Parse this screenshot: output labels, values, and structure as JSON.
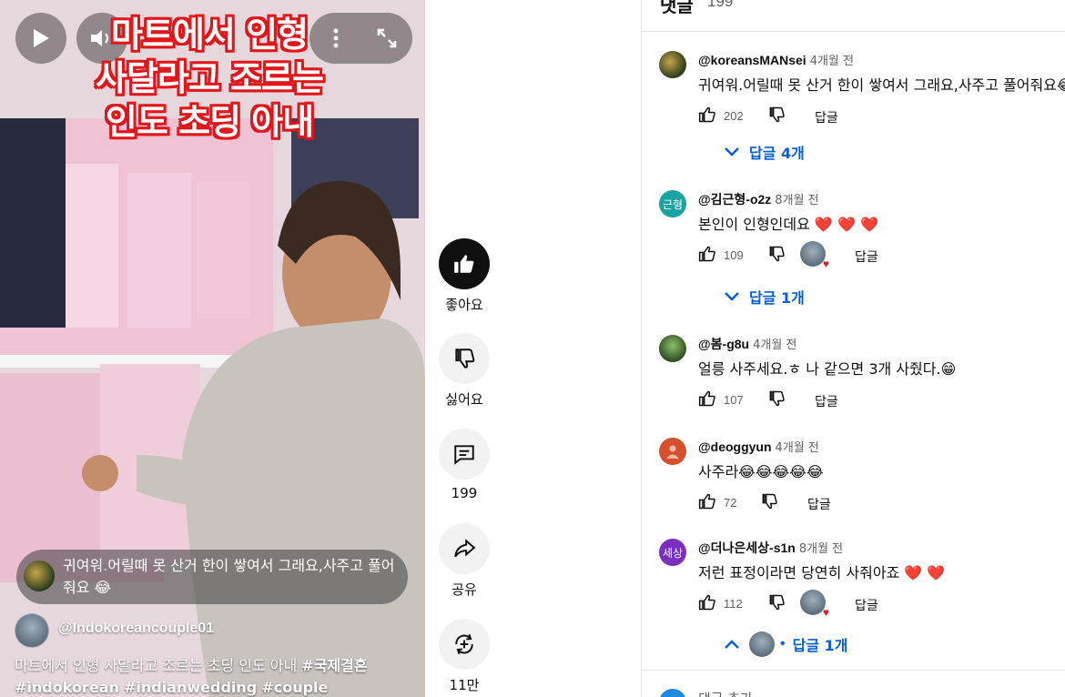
{
  "video": {
    "title_overlay": [
      "마트에서 인형",
      "사달라고 조르는",
      "인도 초딩 아내"
    ],
    "pinned_comment": "귀여워.어릴때 못 산거 한이 쌓여서 그래요,사주고 풀어줘요 😂",
    "channel": "@Indokoreancouple01",
    "description_text": "마트에서 인형 사달라고 조르는 초딩 인도 아내 ",
    "tags": [
      "#국제결혼",
      "#indokorean",
      "#indianwedding",
      "#couple"
    ]
  },
  "actions": {
    "like_label": "좋아요",
    "dislike_label": "싫어요",
    "comments_count": "199",
    "share_label": "공유",
    "remix_count": "11만"
  },
  "panel": {
    "title": "댓글",
    "count": "199",
    "add_comment_placeholder": "댓글 추가..."
  },
  "comments": [
    {
      "author": "@koreansMANsei",
      "time": "4개월 전",
      "text": "귀여워.어릴때 못 산거 한이 쌓여서 그래요,사주고 풀어줘요😂",
      "likes": "202",
      "reply": "답글",
      "replies": "답글 4개",
      "avatar_color": "#5a6b2a"
    },
    {
      "author": "@김근형-o2z",
      "time": "8개월 전",
      "text": "본인이 인형인데요 ❤️ ❤️ ❤️",
      "likes": "109",
      "reply": "답글",
      "replies": "답글 1개",
      "avatar_text": "근형",
      "avatar_color": "#1aa3a3"
    },
    {
      "author": "@봄-g8u",
      "time": "4개월 전",
      "text": "얼릉 사주세요.ㅎ 나 같으면 3개 사줬다.😁",
      "likes": "107",
      "reply": "답글",
      "avatar_color": "#4b7a3b"
    },
    {
      "author": "@deoggyun",
      "time": "4개월 전",
      "text": "사주라😂😂😂😂😂",
      "likes": "72",
      "reply": "답글",
      "avatar_color": "#d6502d"
    },
    {
      "author": "@더나은세상-s1n",
      "time": "8개월 전",
      "text": "저런 표정이라면 당연히 사줘아죠 ❤️ ❤️",
      "likes": "112",
      "reply": "답글",
      "replies": "답글 1개",
      "avatar_text": "세상",
      "avatar_color": "#7b2fbe"
    }
  ],
  "colors": {
    "accent_blue": "#065fd4",
    "overlay_red": "#e0161b"
  }
}
